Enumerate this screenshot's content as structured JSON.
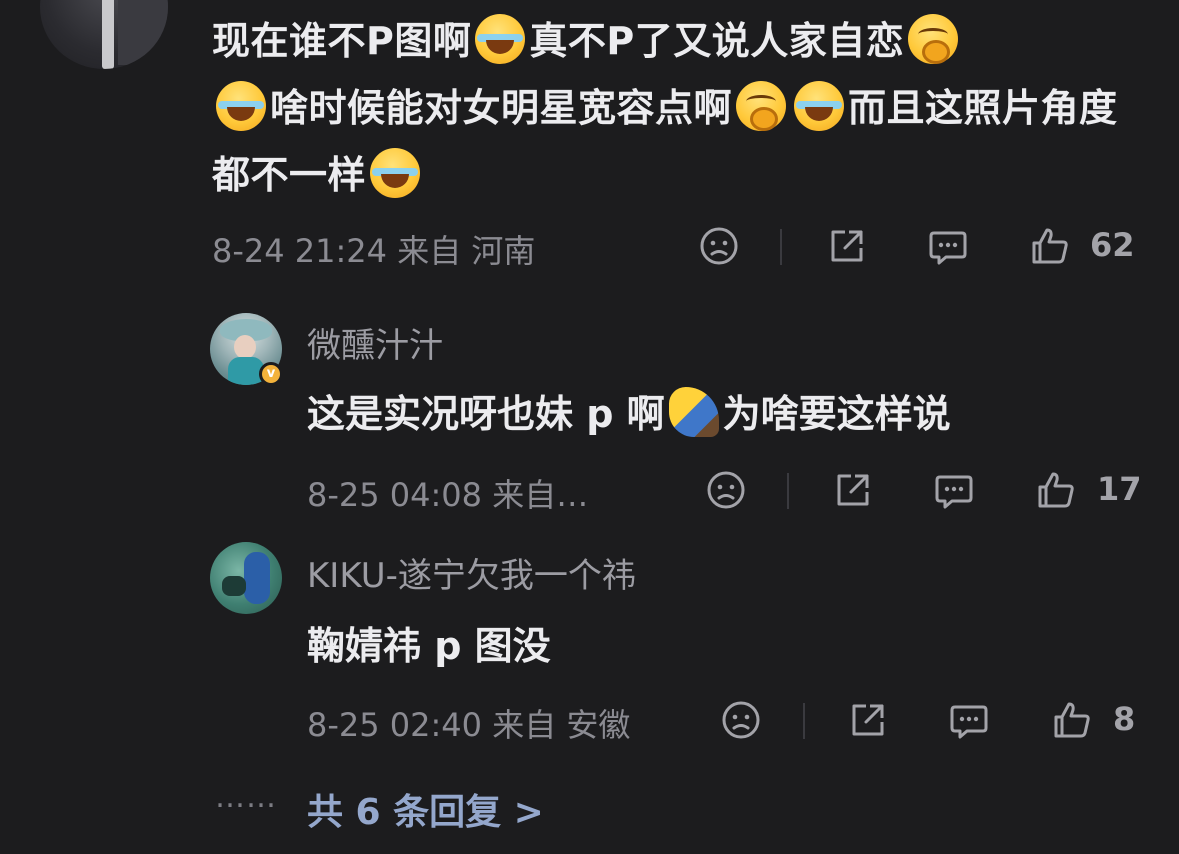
{
  "main_comment": {
    "text_parts": [
      "现在谁不P图啊",
      "真不P了又说人家自恋",
      "啥时候能对女明星宽容点啊",
      "而且这照片角度都不一样"
    ],
    "time": "8-24 21:24",
    "location": "来自 河南",
    "like_count": "62"
  },
  "replies": [
    {
      "username": "微醺汁汁",
      "text_before": "这是实况呀也妹 p 啊",
      "text_after": "为啥要这样说",
      "time": "8-25 04:08",
      "location": "来自…",
      "like_count": "17",
      "verified_mark": "v"
    },
    {
      "username": "KIKU-遂宁欠我一个祎",
      "text": "鞠婧祎 p 图没",
      "time": "8-25 02:40",
      "location": "来自 安徽",
      "like_count": "8"
    }
  ],
  "more": {
    "dots": "……",
    "label": "共 6 条回复 >"
  },
  "icons": [
    "sad-face-icon",
    "share-icon",
    "comment-icon",
    "like-icon",
    "laugh-cry-emoji",
    "hold-back-tears-emoji",
    "bow-emoji"
  ],
  "colors": {
    "background": "#1c1c1e",
    "text_primary": "#ececef",
    "text_secondary": "#8b8b92",
    "link": "#94a7cc",
    "badge": "#f3b23b"
  }
}
